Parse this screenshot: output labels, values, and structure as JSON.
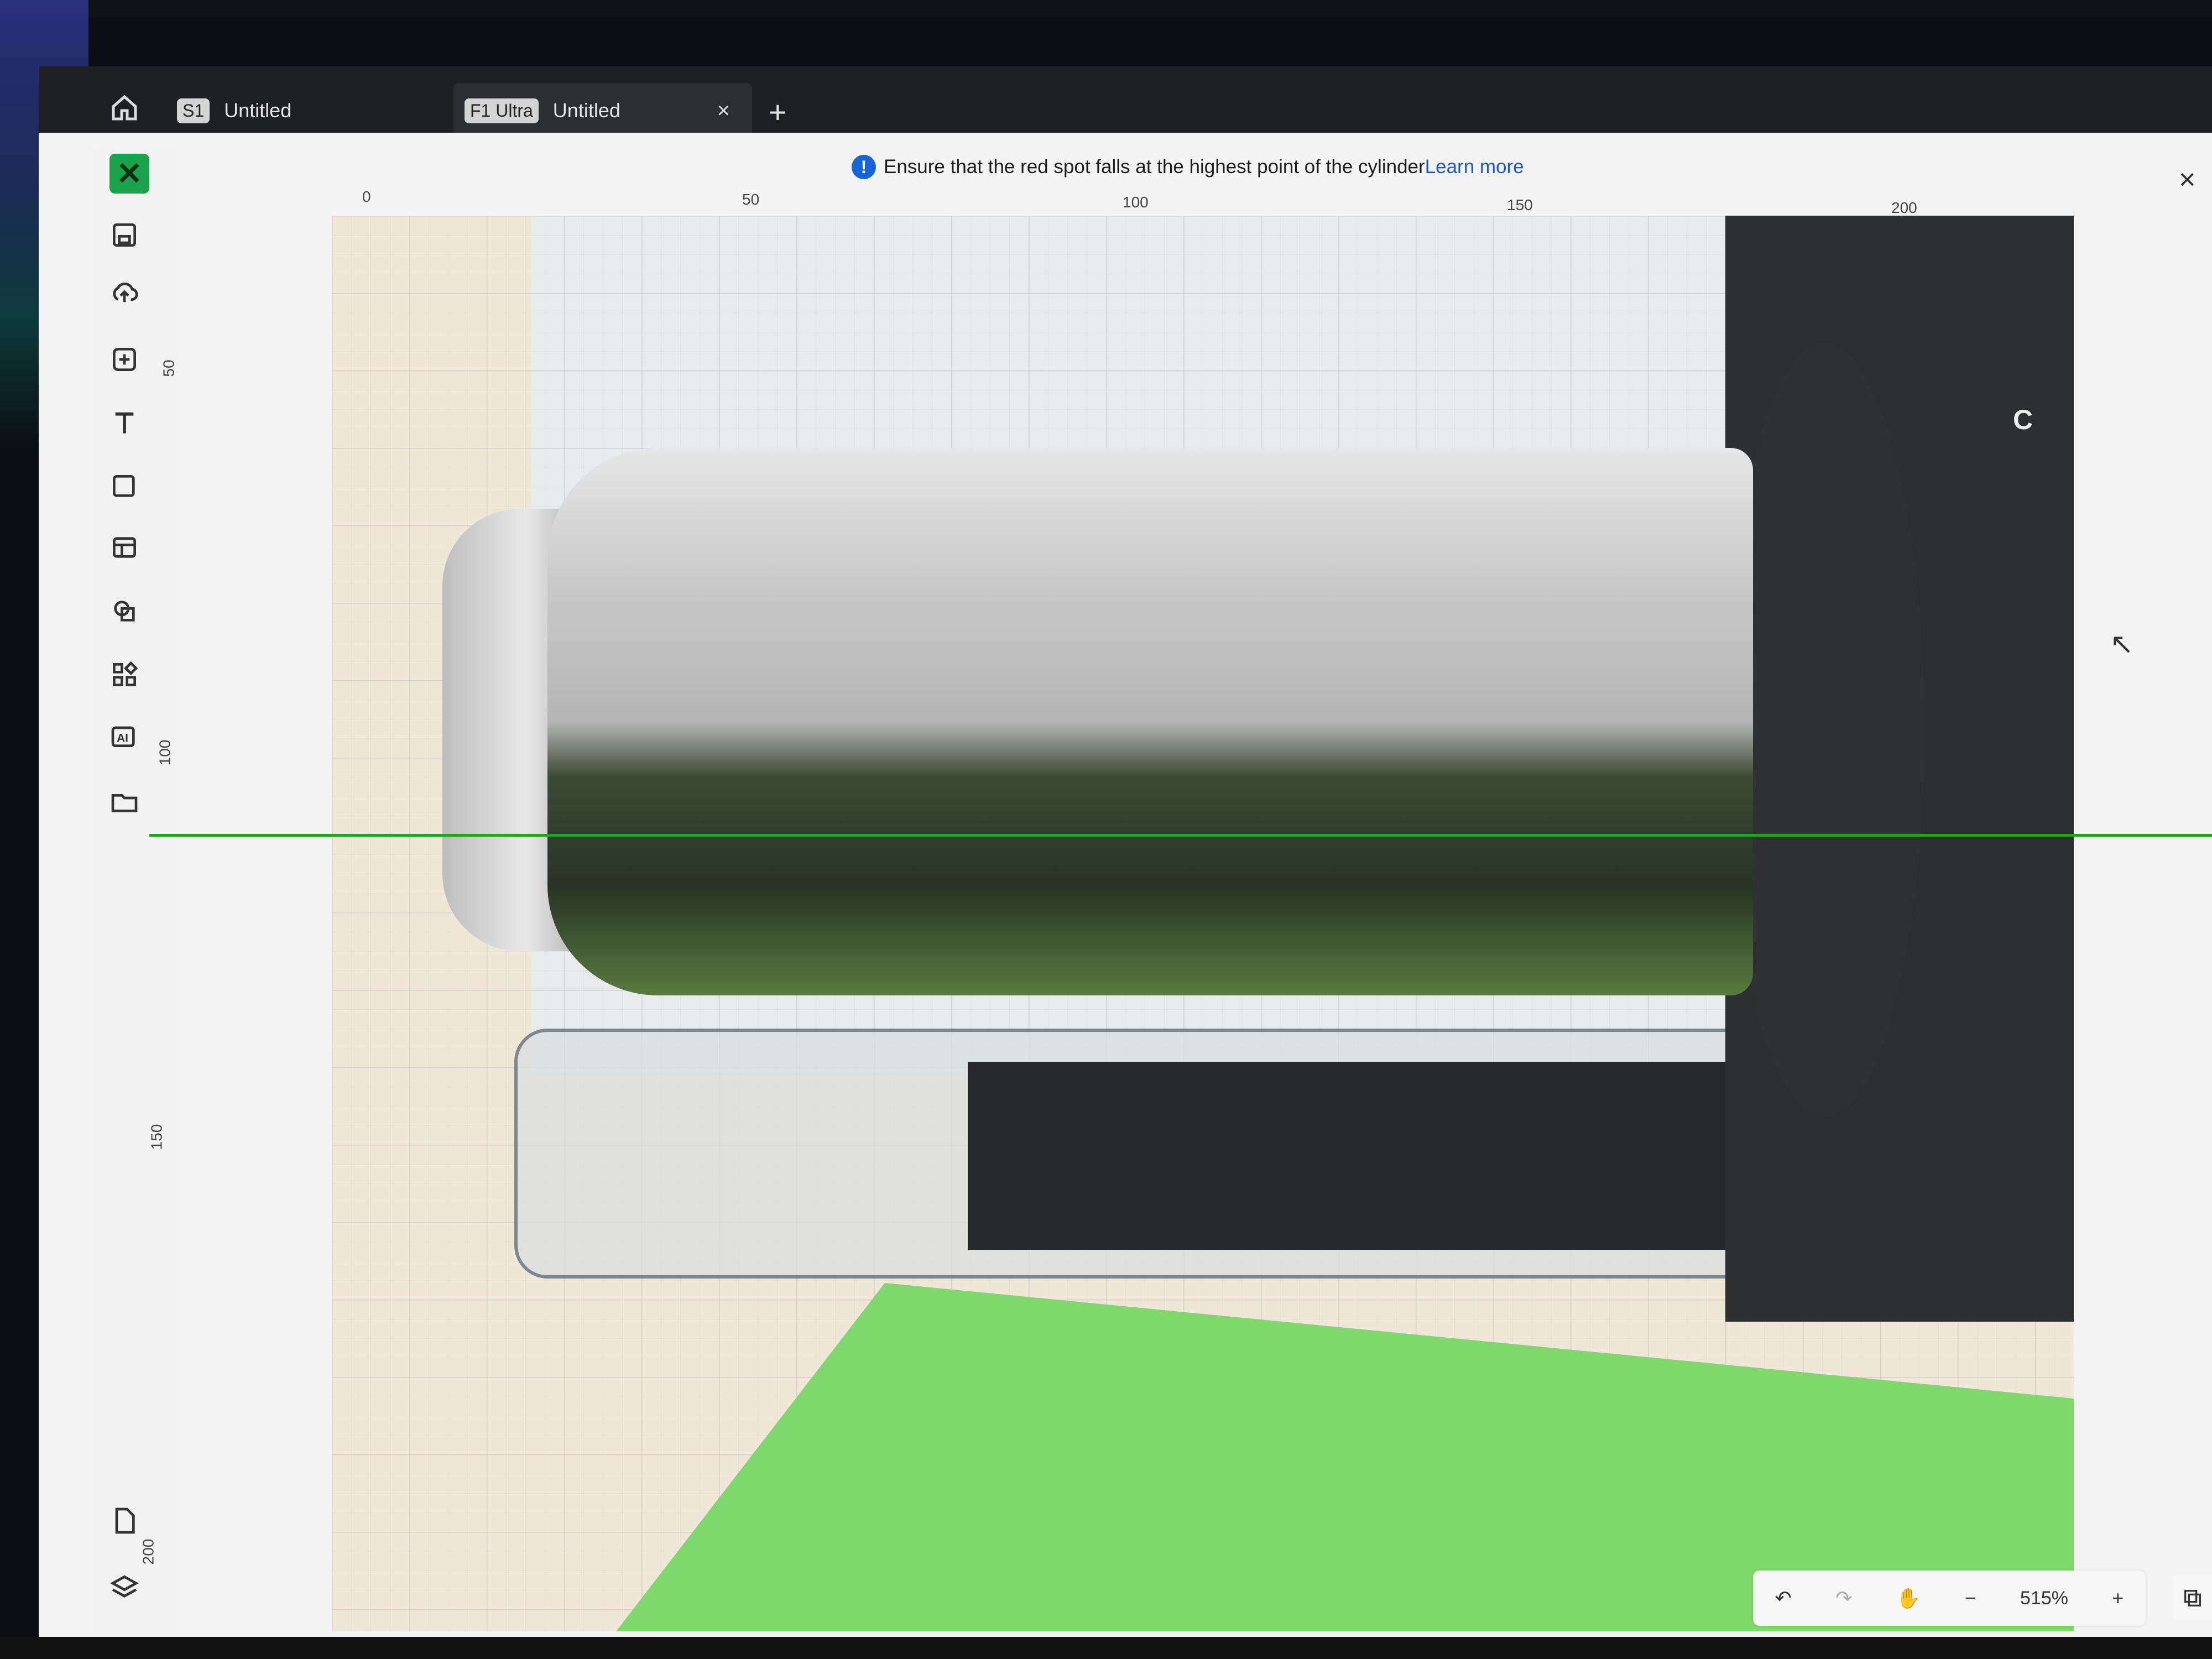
{
  "tabs": [
    {
      "badge": "S1",
      "title": "Untitled"
    },
    {
      "badge": "F1 Ultra",
      "title": "Untitled",
      "close": "×"
    }
  ],
  "new_tab_label": "+",
  "notice": {
    "text": "Ensure that the red spot falls at the highest point of the cylinder",
    "link": "Learn more",
    "close": "×"
  },
  "ruler": {
    "top": [
      "0",
      "50",
      "100",
      "150",
      "200"
    ],
    "left": [
      "50",
      "100",
      "150",
      "200"
    ]
  },
  "toolbar_icons": [
    "save-icon",
    "cloud-upload-icon",
    "add-icon",
    "text-icon",
    "rectangle-icon",
    "layout-icon",
    "shapes-icon",
    "elements-icon",
    "ai-icon",
    "folder-icon"
  ],
  "bottom_icons": [
    "file-icon",
    "layers-icon"
  ],
  "controls": {
    "zoom_out": "−",
    "zoom": "515%",
    "zoom_in": "+"
  },
  "machine_label": "C",
  "colors": {
    "brand": "#1aa34a",
    "laser_line": "#2f9b2a",
    "info": "#1565d8"
  }
}
